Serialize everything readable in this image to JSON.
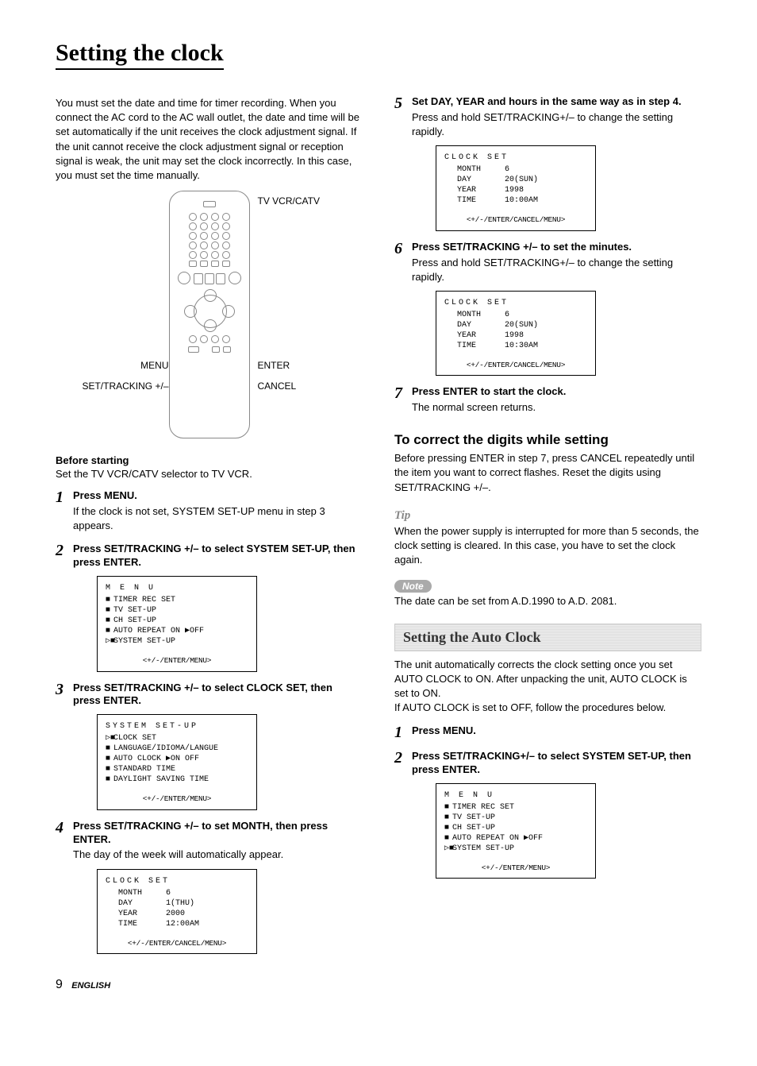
{
  "title": "Setting the clock",
  "intro": "You must set the date and time for timer recording. When you connect the AC cord to the AC wall outlet, the date and time will be set automatically if the unit receives the clock adjustment signal. If the unit cannot receive the clock adjustment signal or reception signal is weak, the unit may set the clock incorrectly. In this case, you must set the time manually.",
  "remote_labels": {
    "top_right": "TV VCR/CATV",
    "mid_left": "MENU",
    "mid_right": "ENTER",
    "bot_left": "SET/TRACKING +/–",
    "bot_right": "CANCEL"
  },
  "before_starting_heading": "Before starting",
  "before_starting_text": "Set the TV VCR/CATV selector to TV VCR.",
  "steps_left": [
    {
      "num": "1",
      "title": "Press MENU.",
      "text": "If the clock is not set, SYSTEM SET-UP menu in step 3 appears."
    },
    {
      "num": "2",
      "title": "Press SET/TRACKING +/– to select SYSTEM SET-UP, then press ENTER.",
      "text": "",
      "osd": {
        "heading": "M E N U",
        "lines": [
          {
            "bullet": "■",
            "text": "TIMER REC SET"
          },
          {
            "bullet": "■",
            "text": "TV SET-UP"
          },
          {
            "bullet": "■",
            "text": "CH SET-UP"
          },
          {
            "bullet": "■",
            "text": "AUTO REPEAT   ON ▶OFF"
          },
          {
            "bullet": "▷■",
            "text": "SYSTEM SET-UP"
          }
        ],
        "footer": "<+/-/ENTER/MENU>"
      }
    },
    {
      "num": "3",
      "title": "Press SET/TRACKING +/– to select CLOCK SET, then press ENTER.",
      "text": "",
      "osd": {
        "heading": "SYSTEM SET-UP",
        "lines": [
          {
            "bullet": "▷■",
            "text": "CLOCK SET"
          },
          {
            "bullet": "■",
            "text": "LANGUAGE/IDIOMA/LANGUE"
          },
          {
            "bullet": "■",
            "text": "AUTO CLOCK ▶ON   OFF"
          },
          {
            "bullet": "■",
            "text": "STANDARD TIME"
          },
          {
            "bullet": "■",
            "text": "DAYLIGHT SAVING TIME"
          }
        ],
        "footer": "<+/-/ENTER/MENU>"
      }
    },
    {
      "num": "4",
      "title": "Press SET/TRACKING +/– to set MONTH, then press ENTER.",
      "text": "The day of the week will automatically appear.",
      "osd": {
        "heading": "CLOCK SET",
        "kv": [
          {
            "k": "MONTH",
            "v": "6",
            "flash": true
          },
          {
            "k": "DAY",
            "v": "1(THU)"
          },
          {
            "k": "YEAR",
            "v": "2000"
          },
          {
            "k": "TIME",
            "v": "12:00AM"
          }
        ],
        "footer": "<+/-/ENTER/CANCEL/MENU>"
      }
    }
  ],
  "steps_right": [
    {
      "num": "5",
      "title": "Set DAY, YEAR and hours in the same way as in step 4.",
      "text": "Press and hold SET/TRACKING+/– to change the setting rapidly.",
      "osd": {
        "heading": "CLOCK SET",
        "kv": [
          {
            "k": "MONTH",
            "v": "6"
          },
          {
            "k": "DAY",
            "v": "20(SUN)"
          },
          {
            "k": "YEAR",
            "v": "1998"
          },
          {
            "k": "TIME",
            "v": "10:00AM",
            "flash": true
          }
        ],
        "footer": "<+/-/ENTER/CANCEL/MENU>"
      }
    },
    {
      "num": "6",
      "title": "Press SET/TRACKING +/– to set the minutes.",
      "text": "Press and hold SET/TRACKING+/– to change the setting rapidly.",
      "osd": {
        "heading": "CLOCK SET",
        "kv": [
          {
            "k": "MONTH",
            "v": "6"
          },
          {
            "k": "DAY",
            "v": "20(SUN)"
          },
          {
            "k": "YEAR",
            "v": "1998"
          },
          {
            "k": "TIME",
            "v": "10:30AM",
            "flash": true
          }
        ],
        "footer": "<+/-/ENTER/CANCEL/MENU>"
      }
    },
    {
      "num": "7",
      "title": "Press ENTER to start the clock.",
      "text": "The normal screen returns."
    }
  ],
  "correct_heading": "To correct the digits while setting",
  "correct_text": "Before pressing ENTER in step 7, press CANCEL repeatedly until the item you want to correct flashes.  Reset the digits using SET/TRACKING +/–.",
  "tip_label": "Tip",
  "tip_text": "When the power supply is interrupted for more than 5 seconds, the clock setting is cleared. In this case, you have to set the clock again.",
  "note_label": "Note",
  "note_text": "The date can be set from A.D.1990 to A.D. 2081.",
  "auto_clock_banner": "Setting the Auto Clock",
  "auto_clock_intro": "The unit automatically corrects the clock setting once you set AUTO CLOCK to ON.  After unpacking the unit, AUTO CLOCK is set to ON.\nIf AUTO CLOCK is set to OFF, follow the procedures below.",
  "auto_steps": [
    {
      "num": "1",
      "title": "Press MENU.",
      "text": ""
    },
    {
      "num": "2",
      "title": "Press SET/TRACKING+/– to select SYSTEM SET-UP, then press ENTER.",
      "text": "",
      "osd": {
        "heading": "M E N U",
        "lines": [
          {
            "bullet": "■",
            "text": "TIMER REC SET"
          },
          {
            "bullet": "■",
            "text": "TV SET-UP"
          },
          {
            "bullet": "■",
            "text": "CH SET-UP"
          },
          {
            "bullet": "■",
            "text": "AUTO REPEAT   ON ▶OFF"
          },
          {
            "bullet": "▷■",
            "text": "SYSTEM SET-UP"
          }
        ],
        "footer": "<+/-/ENTER/MENU>"
      }
    }
  ],
  "page_number": "9",
  "page_lang": "ENGLISH"
}
